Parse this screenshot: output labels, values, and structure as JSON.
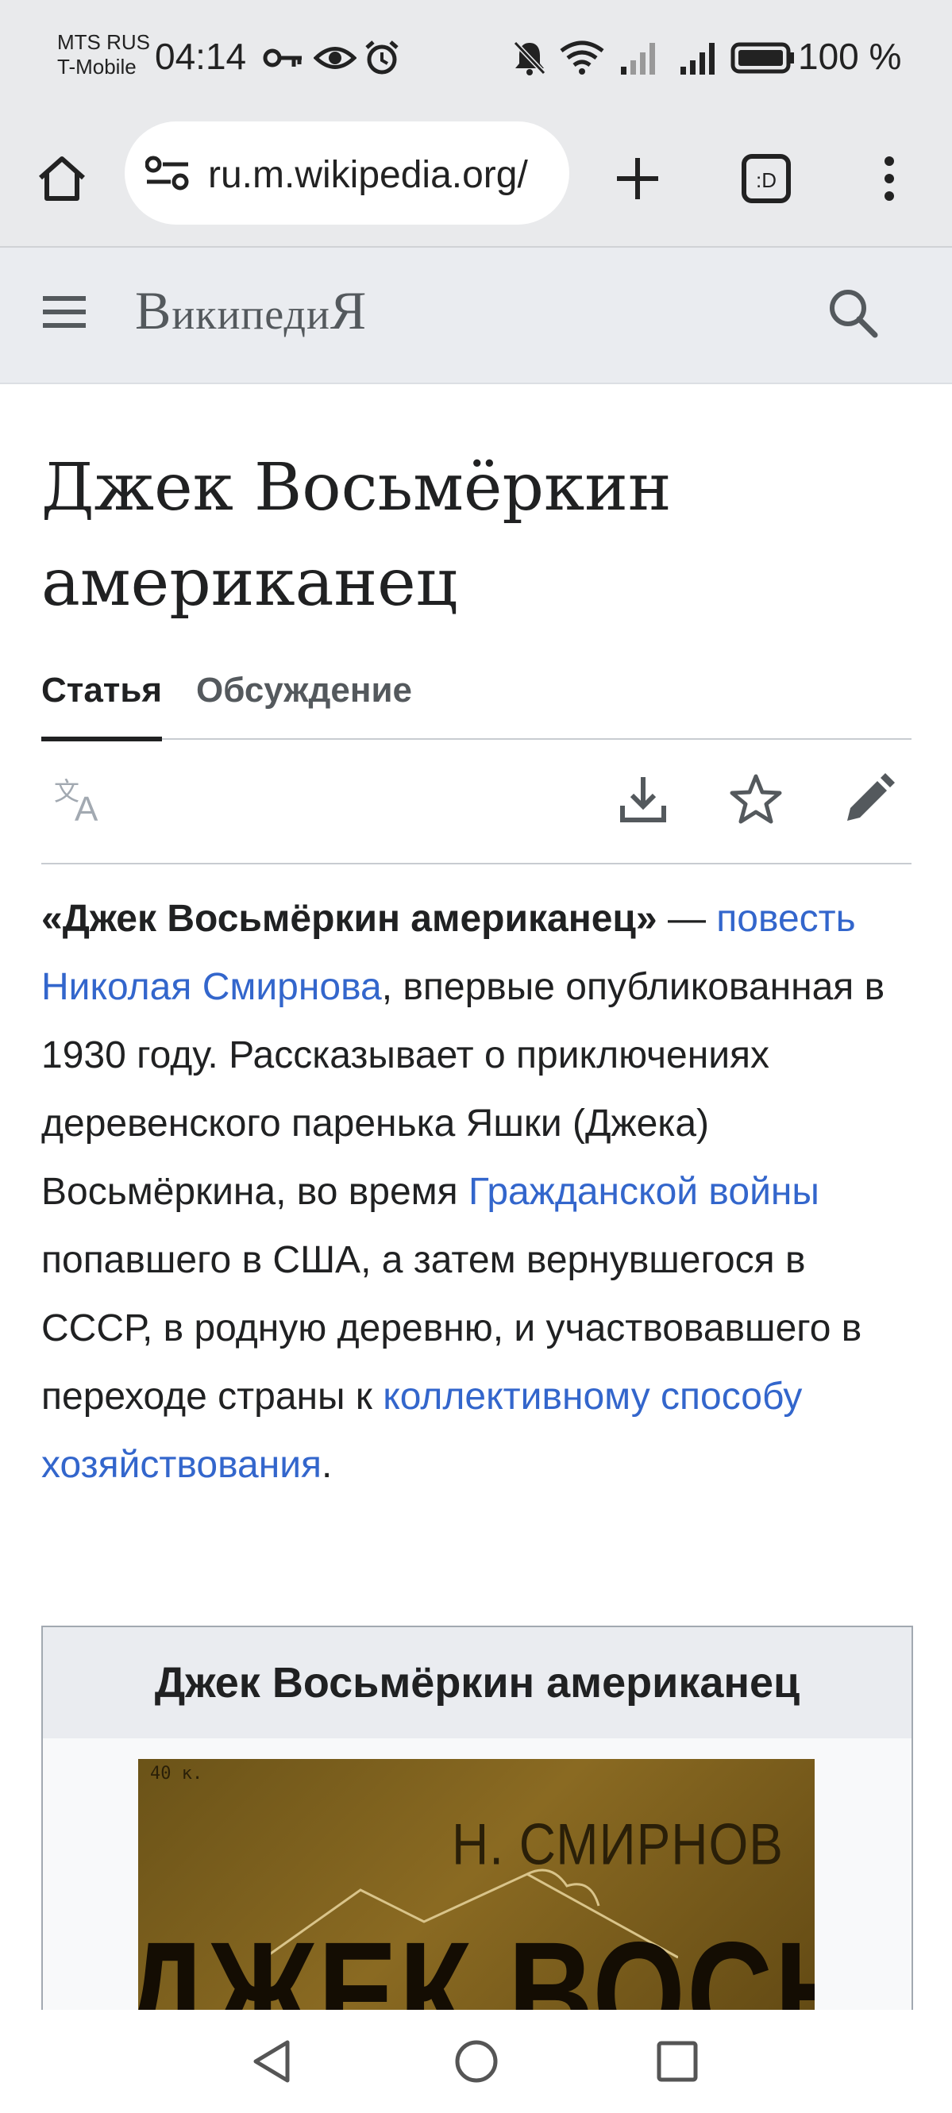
{
  "status": {
    "carrier_line1": "MTS RUS",
    "carrier_line2": "T-Mobile",
    "time": "04:14",
    "battery": "100 %"
  },
  "browser": {
    "url": "ru.m.wikipedia.org/",
    "icons": [
      "home-icon",
      "site-settings-icon",
      "new-tab-icon",
      "tab-switcher-icon",
      "overflow-menu-icon"
    ]
  },
  "wiki": {
    "logo_big_1": "В",
    "logo_small": "икипеди",
    "logo_big_2": "Я"
  },
  "article": {
    "title": "Джек Восьмёркин американец",
    "tabs": [
      {
        "label": "Статья",
        "active": true
      },
      {
        "label": "Обсуждение",
        "active": false
      }
    ],
    "lead": {
      "bold": "«Джек Восьмёркин американец»",
      "t1": " — ",
      "link1": "повесть Николая Смирнова",
      "t2": ", впервые опубликованная в 1930 году. Рассказывает о приключениях деревенского паренька Яшки (Джека) Восьмёркина, во время ",
      "link2": "Гражданской войны",
      "t3": " попавшего в США, а затем вернувшегося в СССР, в родную деревню, и участвовавшего в переходе страны к ",
      "link3": "коллективному способу хозяйствования",
      "t4": "."
    }
  },
  "infobox": {
    "title": "Джек Восьмёркин американец",
    "cover_price": "40 к.",
    "cover_author": "Н. СМИРНОВ",
    "cover_title": "ДЖЕК ВОСЬМЁРКИН"
  },
  "colors": {
    "link": "#3366cc",
    "text": "#202122",
    "header_bg": "#eaecf0"
  }
}
